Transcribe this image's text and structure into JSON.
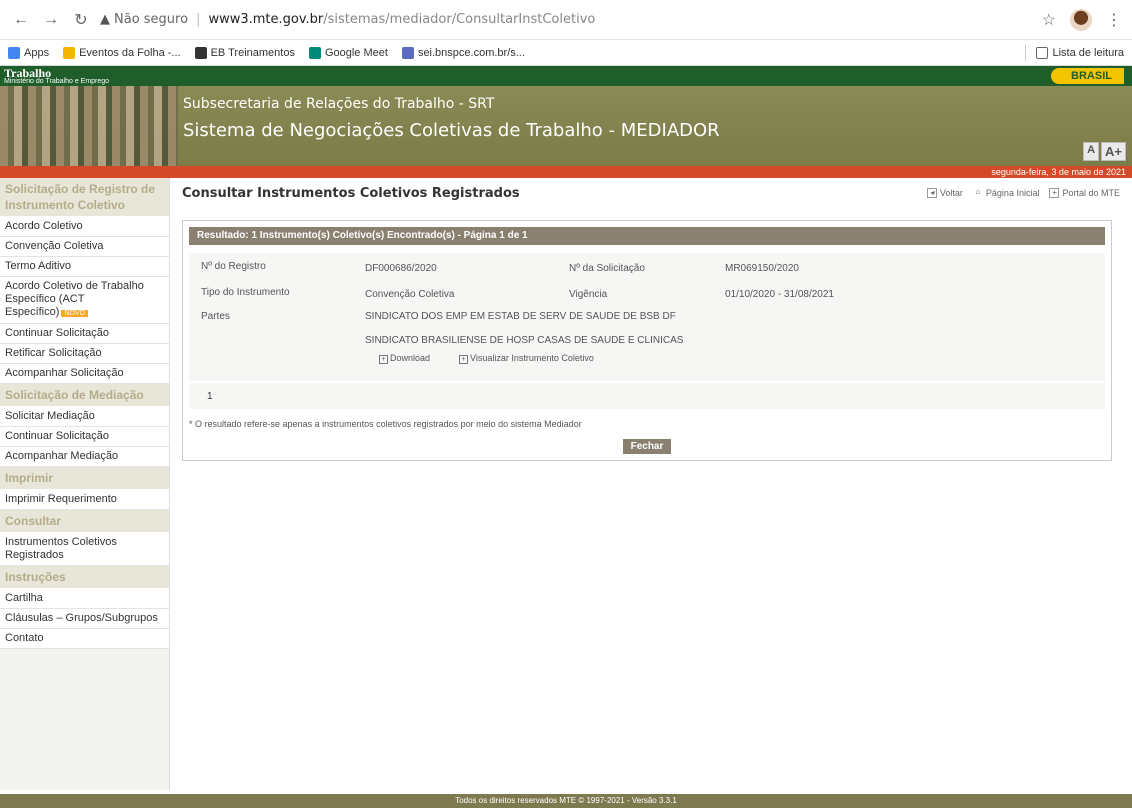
{
  "browser": {
    "not_secure": "Não seguro",
    "url_host": "www3.mte.gov.br",
    "url_path": "/sistemas/mediador/ConsultarInstColetivo"
  },
  "bookmarks": [
    {
      "label": "Apps",
      "color": "#4285f4"
    },
    {
      "label": "Eventos da Folha -...",
      "color": "#f4b400"
    },
    {
      "label": "EB Treinamentos",
      "color": "#333333"
    },
    {
      "label": "Google Meet",
      "color": "#00897b"
    },
    {
      "label": "sei.bnspce.com.br/s...",
      "color": "#5c6bc0"
    }
  ],
  "reading_list": "Lista de leitura",
  "header": {
    "logo": "Trabalho",
    "logo_sub": "Ministério do Trabalho e Emprego",
    "brasil": "BRASIL",
    "line1": "Subsecretaria de Relações do Trabalho - SRT",
    "line2": "Sistema de Negociações Coletivas de Trabalho - MEDIADOR",
    "font_small": "A",
    "font_big": "A+",
    "date": "segunda-feira, 3 de maio de 2021"
  },
  "sidebar": [
    {
      "type": "head",
      "label": "Solicitação de Registro de Instrumento Coletivo"
    },
    {
      "type": "item",
      "label": "Acordo Coletivo"
    },
    {
      "type": "item",
      "label": "Convenção Coletiva"
    },
    {
      "type": "item",
      "label": "Termo Aditivo"
    },
    {
      "type": "item",
      "label": "Acordo Coletivo de Trabalho Específico (ACT Específico)",
      "tag": "NOVO"
    },
    {
      "type": "item",
      "label": "Continuar Solicitação"
    },
    {
      "type": "item",
      "label": "Retificar Solicitação"
    },
    {
      "type": "item",
      "label": "Acompanhar Solicitação"
    },
    {
      "type": "head",
      "label": "Solicitação de Mediação"
    },
    {
      "type": "item",
      "label": "Solicitar Mediação"
    },
    {
      "type": "item",
      "label": "Continuar Solicitação"
    },
    {
      "type": "item",
      "label": "Acompanhar Mediação"
    },
    {
      "type": "head",
      "label": "Imprimir"
    },
    {
      "type": "item",
      "label": "Imprimir Requerimento"
    },
    {
      "type": "head",
      "label": "Consultar"
    },
    {
      "type": "item",
      "label": "Instrumentos Coletivos Registrados"
    },
    {
      "type": "head",
      "label": "Instruções"
    },
    {
      "type": "item",
      "label": "Cartilha"
    },
    {
      "type": "item",
      "label": "Cláusulas – Grupos/Subgrupos"
    },
    {
      "type": "item",
      "label": "Contato"
    }
  ],
  "main": {
    "title": "Consultar Instrumentos Coletivos Registrados",
    "links": [
      "Voltar",
      "Página Inicial",
      "Portal do MTE"
    ],
    "result_header": "Resultado: 1 Instrumento(s) Coletivo(s) Encontrado(s) - Página 1 de 1",
    "labels": {
      "registro": "Nº do Registro",
      "solicitacao": "Nº da Solicitação",
      "tipo": "Tipo do Instrumento",
      "vigencia": "Vigência",
      "partes": "Partes"
    },
    "values": {
      "registro": "DF000686/2020",
      "solicitacao": "MR069150/2020",
      "tipo": "Convenção Coletiva",
      "vigencia": "01/10/2020 - 31/08/2021",
      "parte1": "SINDICATO DOS EMP EM ESTAB DE SERV DE SAUDE DE BSB DF",
      "parte2": "SINDICATO BRASILIENSE DE HOSP CASAS DE SAUDE E CLINICAS"
    },
    "download": "Download",
    "visualizar": "Visualizar Instrumento Coletivo",
    "counter": "1",
    "footnote": "* O resultado refere-se apenas a instrumentos coletivos registrados por meio do sistema Mediador",
    "close": "Fechar"
  },
  "footer": "Todos os direitos reservados MTE © 1997-2021 - Versão 3.3.1"
}
